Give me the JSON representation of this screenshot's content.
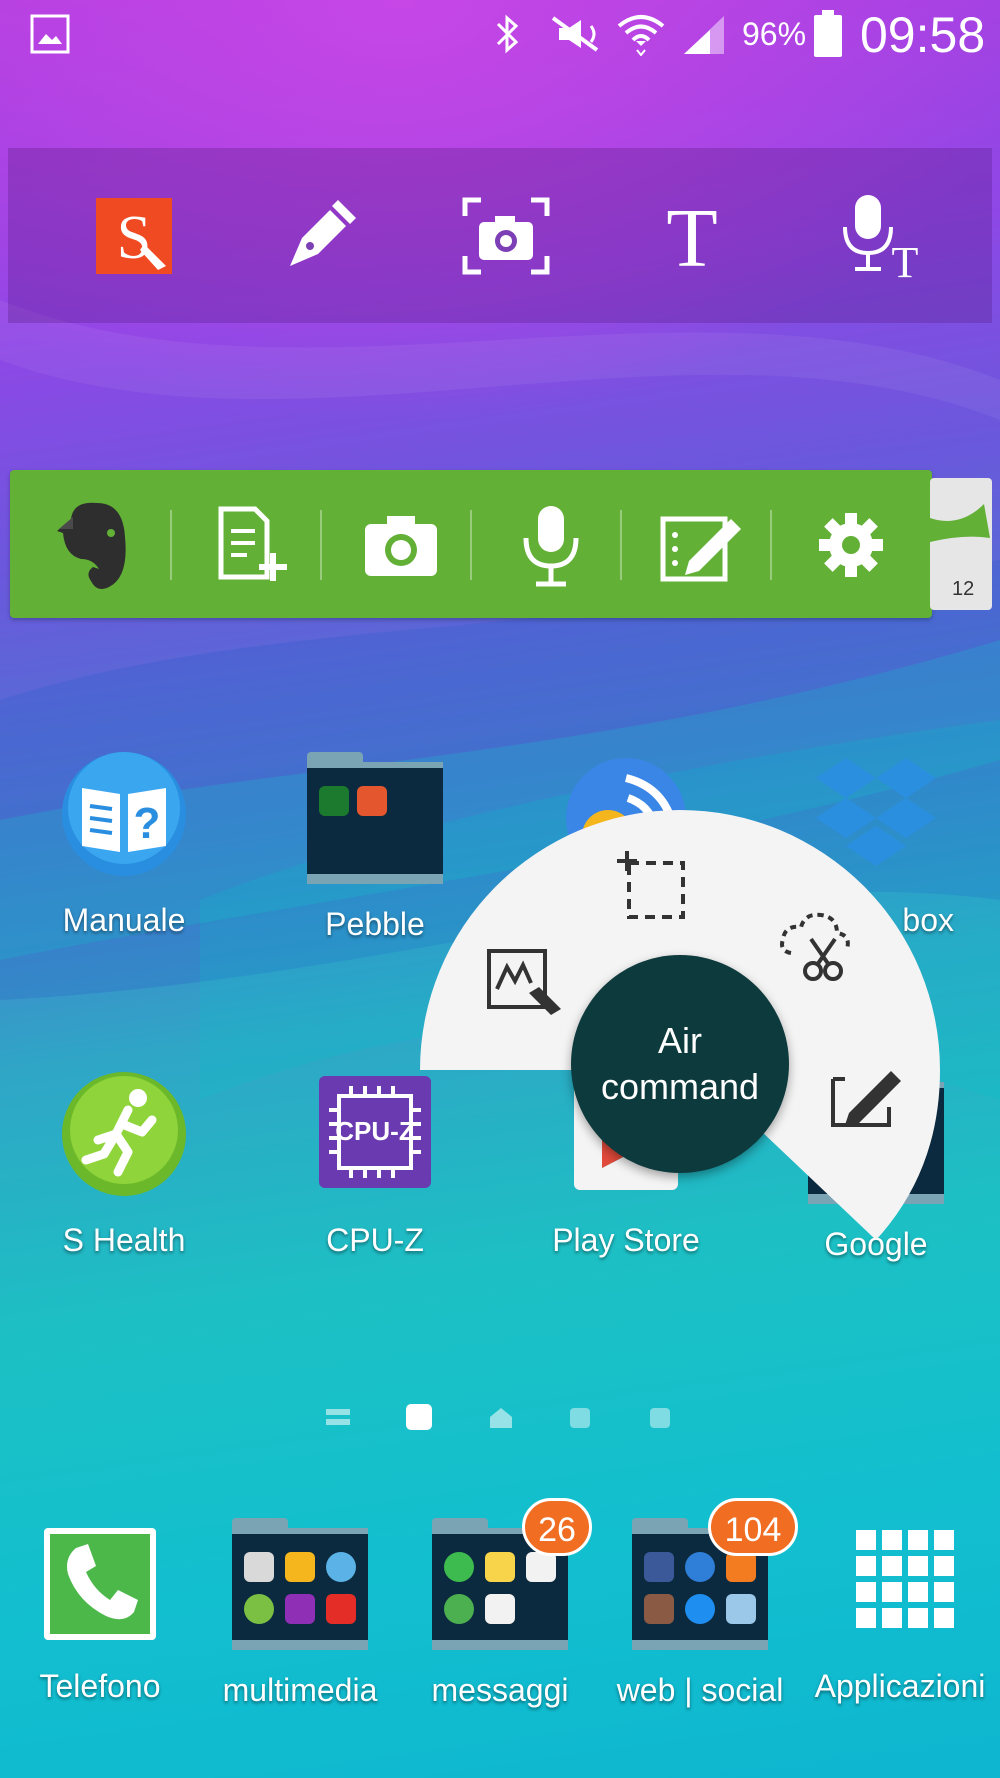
{
  "status_bar": {
    "battery_percent": "96%",
    "time": "09:58",
    "icons": [
      "gallery-notification-icon",
      "bluetooth-icon",
      "mute-icon",
      "wifi-icon",
      "signal-icon",
      "battery-icon"
    ]
  },
  "pen_toolbar": {
    "items": [
      {
        "name": "s-note-icon"
      },
      {
        "name": "pen-icon"
      },
      {
        "name": "screen-capture-icon"
      },
      {
        "name": "text-icon"
      },
      {
        "name": "voice-to-text-icon"
      }
    ]
  },
  "evernote_widget": {
    "buttons": [
      "evernote-logo-icon",
      "new-note-icon",
      "camera-icon",
      "microphone-icon",
      "sketch-icon",
      "settings-icon"
    ],
    "side_widget_count": "12"
  },
  "home_apps": [
    {
      "label": "Manuale"
    },
    {
      "label": "Pebble"
    },
    {
      "label": "box"
    },
    {
      "label": "S Health"
    },
    {
      "label": "CPU-Z"
    },
    {
      "label": "Play Store"
    },
    {
      "label": "Google"
    }
  ],
  "cpuz_icon_text": "CPU-Z",
  "air_command": {
    "center_line1": "Air",
    "center_line2": "command",
    "items": [
      "action-memo-icon",
      "smart-select-icon",
      "image-clip-icon",
      "screen-write-icon"
    ]
  },
  "page_indicator": {
    "pages": 5,
    "current": 2
  },
  "dock": [
    {
      "label": "Telefono"
    },
    {
      "label": "multimedia"
    },
    {
      "label": "messaggi",
      "badge": "26"
    },
    {
      "label": "web | social",
      "badge": "104"
    },
    {
      "label": "Applicazioni"
    }
  ],
  "colors": {
    "evernote_green": "#63b037",
    "badge_orange": "#f06d22",
    "air_command_center": "#0d3a3c"
  }
}
